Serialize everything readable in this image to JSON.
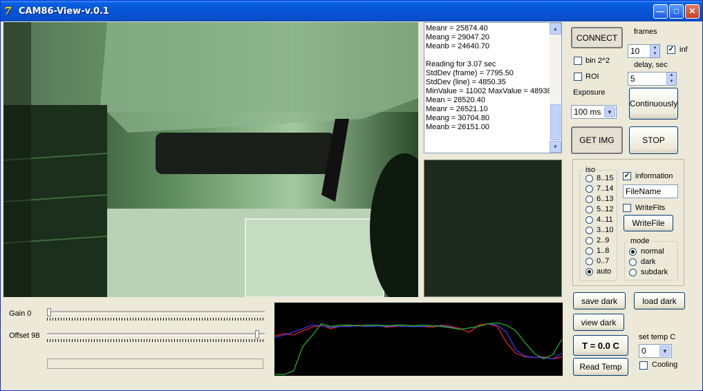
{
  "window": {
    "title": "CAM86-View-v.0.1",
    "app_icon_text": "7"
  },
  "log": {
    "lines": [
      "Meanr = 25874.40",
      "Meang = 29047.20",
      "Meanb = 24640.70",
      "",
      "Reading for 3.07 sec",
      "StdDev (frame) = 7795.50",
      "StdDev (line) = 4850.35",
      "MinValue = 11002 MaxValue = 48938",
      "Mean = 28520.40",
      "Meanr = 26521.10",
      "Meang = 30704.80",
      "Meanb = 26151.00"
    ]
  },
  "controls": {
    "connect": "CONNECT",
    "bin": "bin 2^2",
    "roi": "ROI",
    "exposure_label": "Exposure",
    "exposure_value": "100 ms",
    "frames_label": "frames",
    "frames_value": "10",
    "inf_label": "inf",
    "delay_label": "delay, sec",
    "delay_value": "5",
    "continuously": "Continuously",
    "get_img": "GET IMG",
    "stop": "STOP"
  },
  "iso": {
    "title": "iso",
    "options": [
      "8..15",
      "7..14",
      "6..13",
      "5..12",
      "4..11",
      "3..10",
      "2..9",
      "1..8",
      "0..7",
      "auto"
    ],
    "selected": "auto"
  },
  "file": {
    "information_label": "information",
    "filename_value": "FileName",
    "writefits_label": "WriteFits",
    "writefile_button": "WriteFile"
  },
  "mode": {
    "title": "mode",
    "options": [
      "normal",
      "dark",
      "subdark"
    ],
    "selected": "normal"
  },
  "dark": {
    "save": "save dark",
    "load": "load dark",
    "view": "view dark"
  },
  "temp": {
    "display": "T = 0.0 C",
    "read": "Read Temp",
    "set_label": "set temp C",
    "set_value": "0",
    "cooling_label": "Cooling"
  },
  "sliders": {
    "gain_label": "Gain 0",
    "gain_value": 0,
    "offset_label": "Offset 98",
    "offset_value": 98,
    "max": 100
  },
  "histogram": {
    "series": [
      {
        "color": "#ff2020",
        "values": [
          0.55,
          0.58,
          0.56,
          0.62,
          0.67,
          0.7,
          0.65,
          0.68,
          0.69,
          0.7,
          0.68,
          0.7,
          0.67,
          0.68,
          0.7,
          0.69,
          0.68,
          0.67,
          0.7,
          0.68,
          0.65,
          0.6,
          0.7,
          0.72,
          0.68,
          0.45,
          0.3,
          0.25,
          0.24,
          0.25,
          0.22,
          0.25
        ]
      },
      {
        "color": "#3a40ff",
        "values": [
          0.53,
          0.56,
          0.6,
          0.65,
          0.7,
          0.69,
          0.67,
          0.68,
          0.68,
          0.69,
          0.68,
          0.69,
          0.68,
          0.69,
          0.68,
          0.68,
          0.68,
          0.69,
          0.69,
          0.67,
          0.64,
          0.66,
          0.68,
          0.72,
          0.7,
          0.6,
          0.35,
          0.26,
          0.24,
          0.24,
          0.22,
          0.3
        ]
      },
      {
        "color": "#20c020",
        "values": [
          0.0,
          0.0,
          0.05,
          0.4,
          0.55,
          0.72,
          0.68,
          0.7,
          0.7,
          0.69,
          0.7,
          0.7,
          0.69,
          0.7,
          0.7,
          0.69,
          0.7,
          0.69,
          0.68,
          0.66,
          0.64,
          0.66,
          0.68,
          0.72,
          0.73,
          0.7,
          0.62,
          0.45,
          0.3,
          0.22,
          0.28,
          0.5
        ]
      }
    ]
  }
}
